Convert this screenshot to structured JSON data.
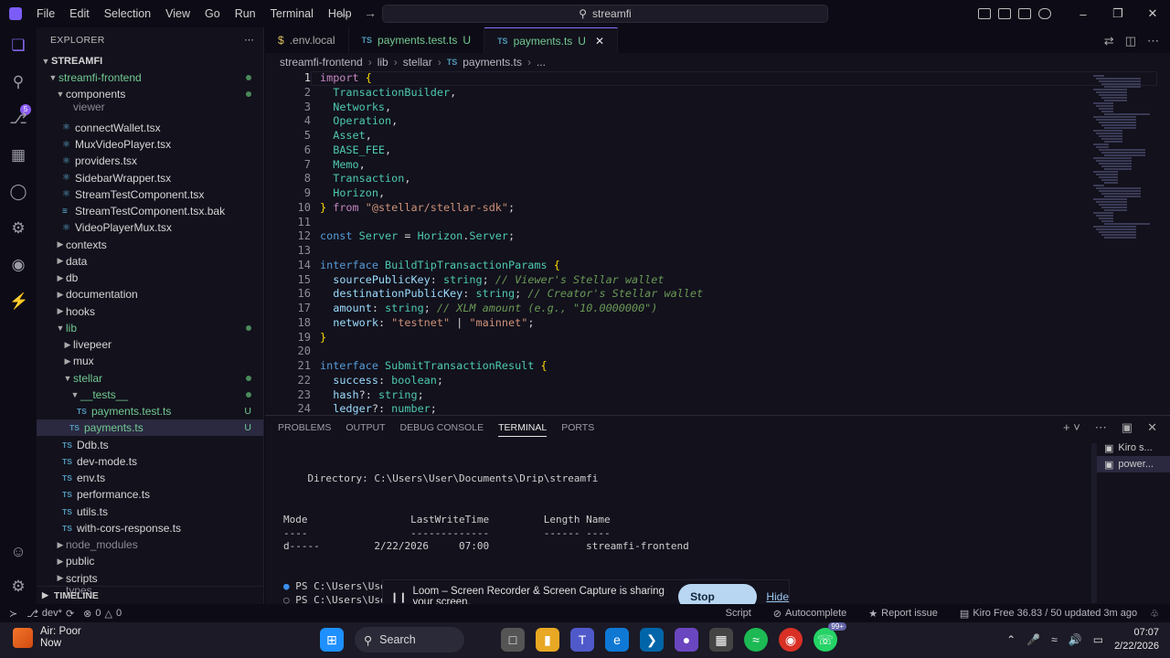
{
  "menu": [
    "File",
    "Edit",
    "Selection",
    "View",
    "Go",
    "Run",
    "Terminal",
    "Help"
  ],
  "command_center": "streamfi",
  "explorer": {
    "title": "EXPLORER",
    "root": "STREAMFI",
    "items": [
      {
        "label": "streamfi-frontend",
        "kind": "folder-open"
      },
      {
        "label": "components",
        "kind": "folder-open"
      },
      {
        "label": "viewer",
        "kind": "clipped"
      },
      {
        "label": "connectWallet.tsx",
        "kind": "tsx"
      },
      {
        "label": "MuxVideoPlayer.tsx",
        "kind": "tsx"
      },
      {
        "label": "providers.tsx",
        "kind": "tsx"
      },
      {
        "label": "SidebarWrapper.tsx",
        "kind": "tsx"
      },
      {
        "label": "StreamTestComponent.tsx",
        "kind": "tsx"
      },
      {
        "label": "StreamTestComponent.tsx.bak",
        "kind": "file"
      },
      {
        "label": "VideoPlayerMux.tsx",
        "kind": "tsx"
      },
      {
        "label": "contexts",
        "kind": "folder"
      },
      {
        "label": "data",
        "kind": "folder"
      },
      {
        "label": "db",
        "kind": "folder"
      },
      {
        "label": "documentation",
        "kind": "folder"
      },
      {
        "label": "hooks",
        "kind": "folder"
      },
      {
        "label": "lib",
        "kind": "folder-open"
      },
      {
        "label": "livepeer",
        "kind": "folder"
      },
      {
        "label": "mux",
        "kind": "folder"
      },
      {
        "label": "stellar",
        "kind": "folder-open"
      },
      {
        "label": "__tests__",
        "kind": "folder-open"
      },
      {
        "label": "payments.test.ts",
        "kind": "ts",
        "badge": "U"
      },
      {
        "label": "payments.ts",
        "kind": "ts",
        "badge": "U"
      },
      {
        "label": "Ddb.ts",
        "kind": "ts"
      },
      {
        "label": "dev-mode.ts",
        "kind": "ts"
      },
      {
        "label": "env.ts",
        "kind": "ts"
      },
      {
        "label": "performance.ts",
        "kind": "ts"
      },
      {
        "label": "utils.ts",
        "kind": "ts"
      },
      {
        "label": "with-cors-response.ts",
        "kind": "ts"
      },
      {
        "label": "node_modules",
        "kind": "folder"
      },
      {
        "label": "public",
        "kind": "folder"
      },
      {
        "label": "scripts",
        "kind": "folder"
      },
      {
        "label": "types",
        "kind": "clipped"
      }
    ],
    "timeline": "TIMELINE"
  },
  "tabs": [
    {
      "label": ".env.local",
      "icon": "$",
      "badge": ""
    },
    {
      "label": "payments.test.ts",
      "icon": "TS",
      "badge": "U"
    },
    {
      "label": "payments.ts",
      "icon": "TS",
      "badge": "U"
    }
  ],
  "breadcrumb": [
    "streamfi-frontend",
    "lib",
    "stellar",
    "payments.ts",
    "..."
  ],
  "code_lines": [
    "import {",
    "  TransactionBuilder,",
    "  Networks,",
    "  Operation,",
    "  Asset,",
    "  BASE_FEE,",
    "  Memo,",
    "  Transaction,",
    "  Horizon,",
    "} from \"@stellar/stellar-sdk\";",
    "",
    "const Server = Horizon.Server;",
    "",
    "interface BuildTipTransactionParams {",
    "  sourcePublicKey: string; // Viewer's Stellar wallet",
    "  destinationPublicKey: string; // Creator's Stellar wallet",
    "  amount: string; // XLM amount (e.g., \"10.0000000\")",
    "  network: \"testnet\" | \"mainnet\";",
    "}",
    "",
    "interface SubmitTransactionResult {",
    "  success: boolean;",
    "  hash?: string;",
    "  ledger?: number;"
  ],
  "panel_tabs": [
    "PROBLEMS",
    "OUTPUT",
    "DEBUG CONSOLE",
    "TERMINAL",
    "PORTS"
  ],
  "terminal": {
    "directory": "    Directory: C:\\Users\\User\\Documents\\Drip\\streamfi",
    "header": "Mode                 LastWriteTime         Length Name",
    "rule": "----                 -------------         ------ ----",
    "row": "d-----         2/22/2026     07:00                streamfi-frontend",
    "prompt1": "PS C:\\Users\\User\\D",
    "prompt2": "PS C:\\Users\\User\\D",
    "instances": [
      "Kiro s...",
      "power..."
    ]
  },
  "loom": {
    "message": "Loom – Screen Recorder & Screen Capture is sharing your screen.",
    "stop": "Stop sharing",
    "hide": "Hide"
  },
  "statusbar": {
    "branch": "dev*",
    "errors": "0",
    "warnings": "0",
    "language": "Script",
    "autocomplete": "Autocomplete",
    "report": "Report issue",
    "kiro": "Kiro Free 36.83 / 50 updated 3m ago"
  },
  "taskbar": {
    "weather_title": "Air: Poor",
    "weather_sub": "Now",
    "search": "Search",
    "badge": "99+",
    "time": "07:07",
    "date": "2/22/2026"
  },
  "colors": {
    "accent": "#8b6cf7",
    "untracked": "#73c991",
    "loom_button": "#b8d6f2"
  }
}
